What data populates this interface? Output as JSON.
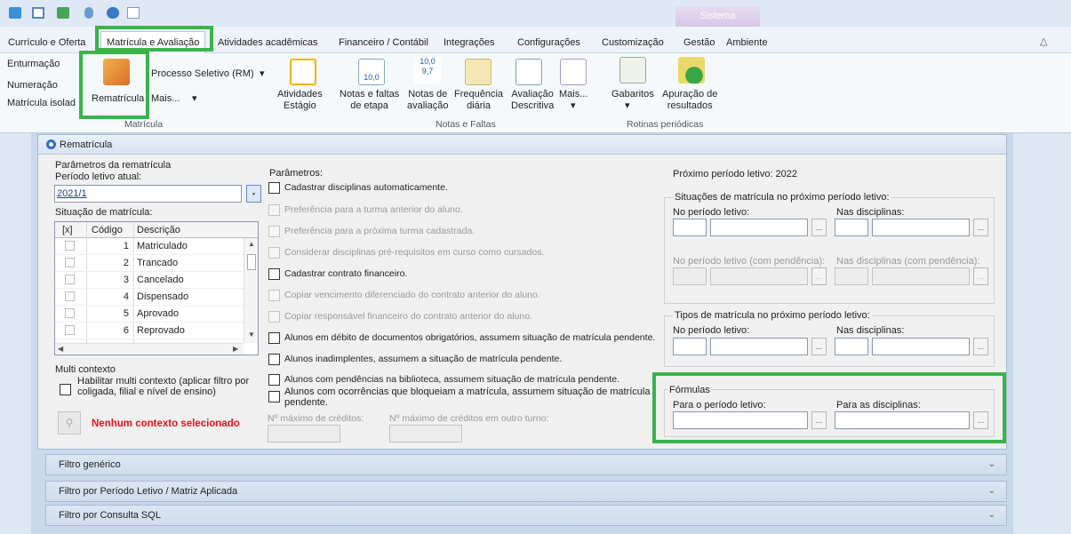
{
  "window": {
    "context_tab": "Sistema"
  },
  "menu": {
    "items": [
      "Currículo e Oferta",
      "Matrícula e Avaliação",
      "Atividades acadêmicas",
      "Financeiro / Contábil",
      "Integrações",
      "Configurações",
      "Customização",
      "Gestão",
      "Ambiente"
    ]
  },
  "ribbon": {
    "left_items": [
      "Enturmação",
      "Numeração",
      "Matrícula isolad"
    ],
    "rematricula": "Rematrícula",
    "processo_seletivo": "Processo Seletivo (RM)",
    "mais1": "Mais...",
    "atividades": [
      "Atividades",
      "Estágio"
    ],
    "group_matricula": "Matrícula",
    "notas_faltas": [
      "Notas e faltas",
      "de etapa"
    ],
    "notas_avaliacao": [
      "Notas de",
      "avaliação"
    ],
    "frequencia": [
      "Frequência",
      "diária"
    ],
    "avaliacao": [
      "Avaliação",
      "Descritiva"
    ],
    "mais2": "Mais...",
    "group_notas": "Notas e Faltas",
    "gabaritos": "Gabaritos",
    "apuracao": [
      "Apuração de",
      "resultados"
    ],
    "group_rotinas": "Rotinas periódicas",
    "icon_notas_value": "10,0",
    "icon_aval_value": [
      "10,0",
      "9,7"
    ]
  },
  "panel": {
    "title": "Rematrícula",
    "parametros_rematricula": "Parâmetros da rematrícula",
    "periodo_atual_label": "Período letivo atual:",
    "periodo_atual_value": "2021/1",
    "situacao_label": "Situação de matrícula:",
    "table_headers": [
      "[x]",
      "Código",
      "Descrição"
    ],
    "table_rows": [
      {
        "code": "1",
        "desc": "Matriculado"
      },
      {
        "code": "2",
        "desc": "Trancado"
      },
      {
        "code": "3",
        "desc": "Cancelado"
      },
      {
        "code": "4",
        "desc": "Dispensado"
      },
      {
        "code": "5",
        "desc": "Aprovado"
      },
      {
        "code": "6",
        "desc": "Reprovado"
      }
    ],
    "multi_contexto": "Multi contexto",
    "habilitar_multi": [
      "Habilitar multi contexto (aplicar filtro por",
      "coligada, filial e nível de ensino)"
    ],
    "nenhum_contexto": "Nenhum contexto selecionado",
    "parametros": "Parâmetros:",
    "options": [
      {
        "label": "Cadastrar disciplinas automaticamente.",
        "enabled": true
      },
      {
        "label": "Preferência para a turma anterior do aluno.",
        "enabled": false
      },
      {
        "label": "Preferência para a próxima turma cadastrada.",
        "enabled": false
      },
      {
        "label": "Considerar disciplinas pré-requisitos em curso como cursados.",
        "enabled": false
      },
      {
        "label": "Cadastrar contrato financeiro.",
        "enabled": true
      },
      {
        "label": "Copiar vencimento diferenciado do contrato anterior do aluno.",
        "enabled": false
      },
      {
        "label": "Copiar responsável financeiro do contrato anterior do aluno.",
        "enabled": false
      },
      {
        "label": "Alunos em débito de documentos obrigatórios, assumem situação de matrícula pendente.",
        "enabled": true
      },
      {
        "label": "Alunos inadimplentes, assumem a situação de matrícula pendente.",
        "enabled": true
      },
      {
        "label": "Alunos com pendências na biblioteca, assumem situação de matrícula pendente.",
        "enabled": true
      }
    ],
    "option_last": [
      "Alunos com ocorrências que bloqueiam a matrícula, assumem situação de matrícula",
      "pendente."
    ],
    "max_creditos": "Nº máximo de créditos:",
    "max_creditos_outro": "Nº máximo de créditos em outro turno:",
    "proximo_periodo": "Próximo período letivo: 2022",
    "situacoes_proximo": "Situações de matrícula no próximo período letivo:",
    "no_periodo": "No período letivo:",
    "nas_disciplinas": "Nas disciplinas:",
    "no_periodo_pend": "No período letivo (com pendência):",
    "nas_disciplinas_pend": "Nas disciplinas (com pendência):",
    "tipos_proximo": "Tipos de matrícula no próximo período letivo:",
    "formulas": "Fórmulas",
    "para_periodo": "Para o período letivo:",
    "para_disciplinas": "Para as disciplinas:",
    "ellipsis": "..."
  },
  "filters": [
    "Filtro genérico",
    "Filtro por Período Letivo / Matriz Aplicada",
    "Filtro por Consulta SQL"
  ]
}
